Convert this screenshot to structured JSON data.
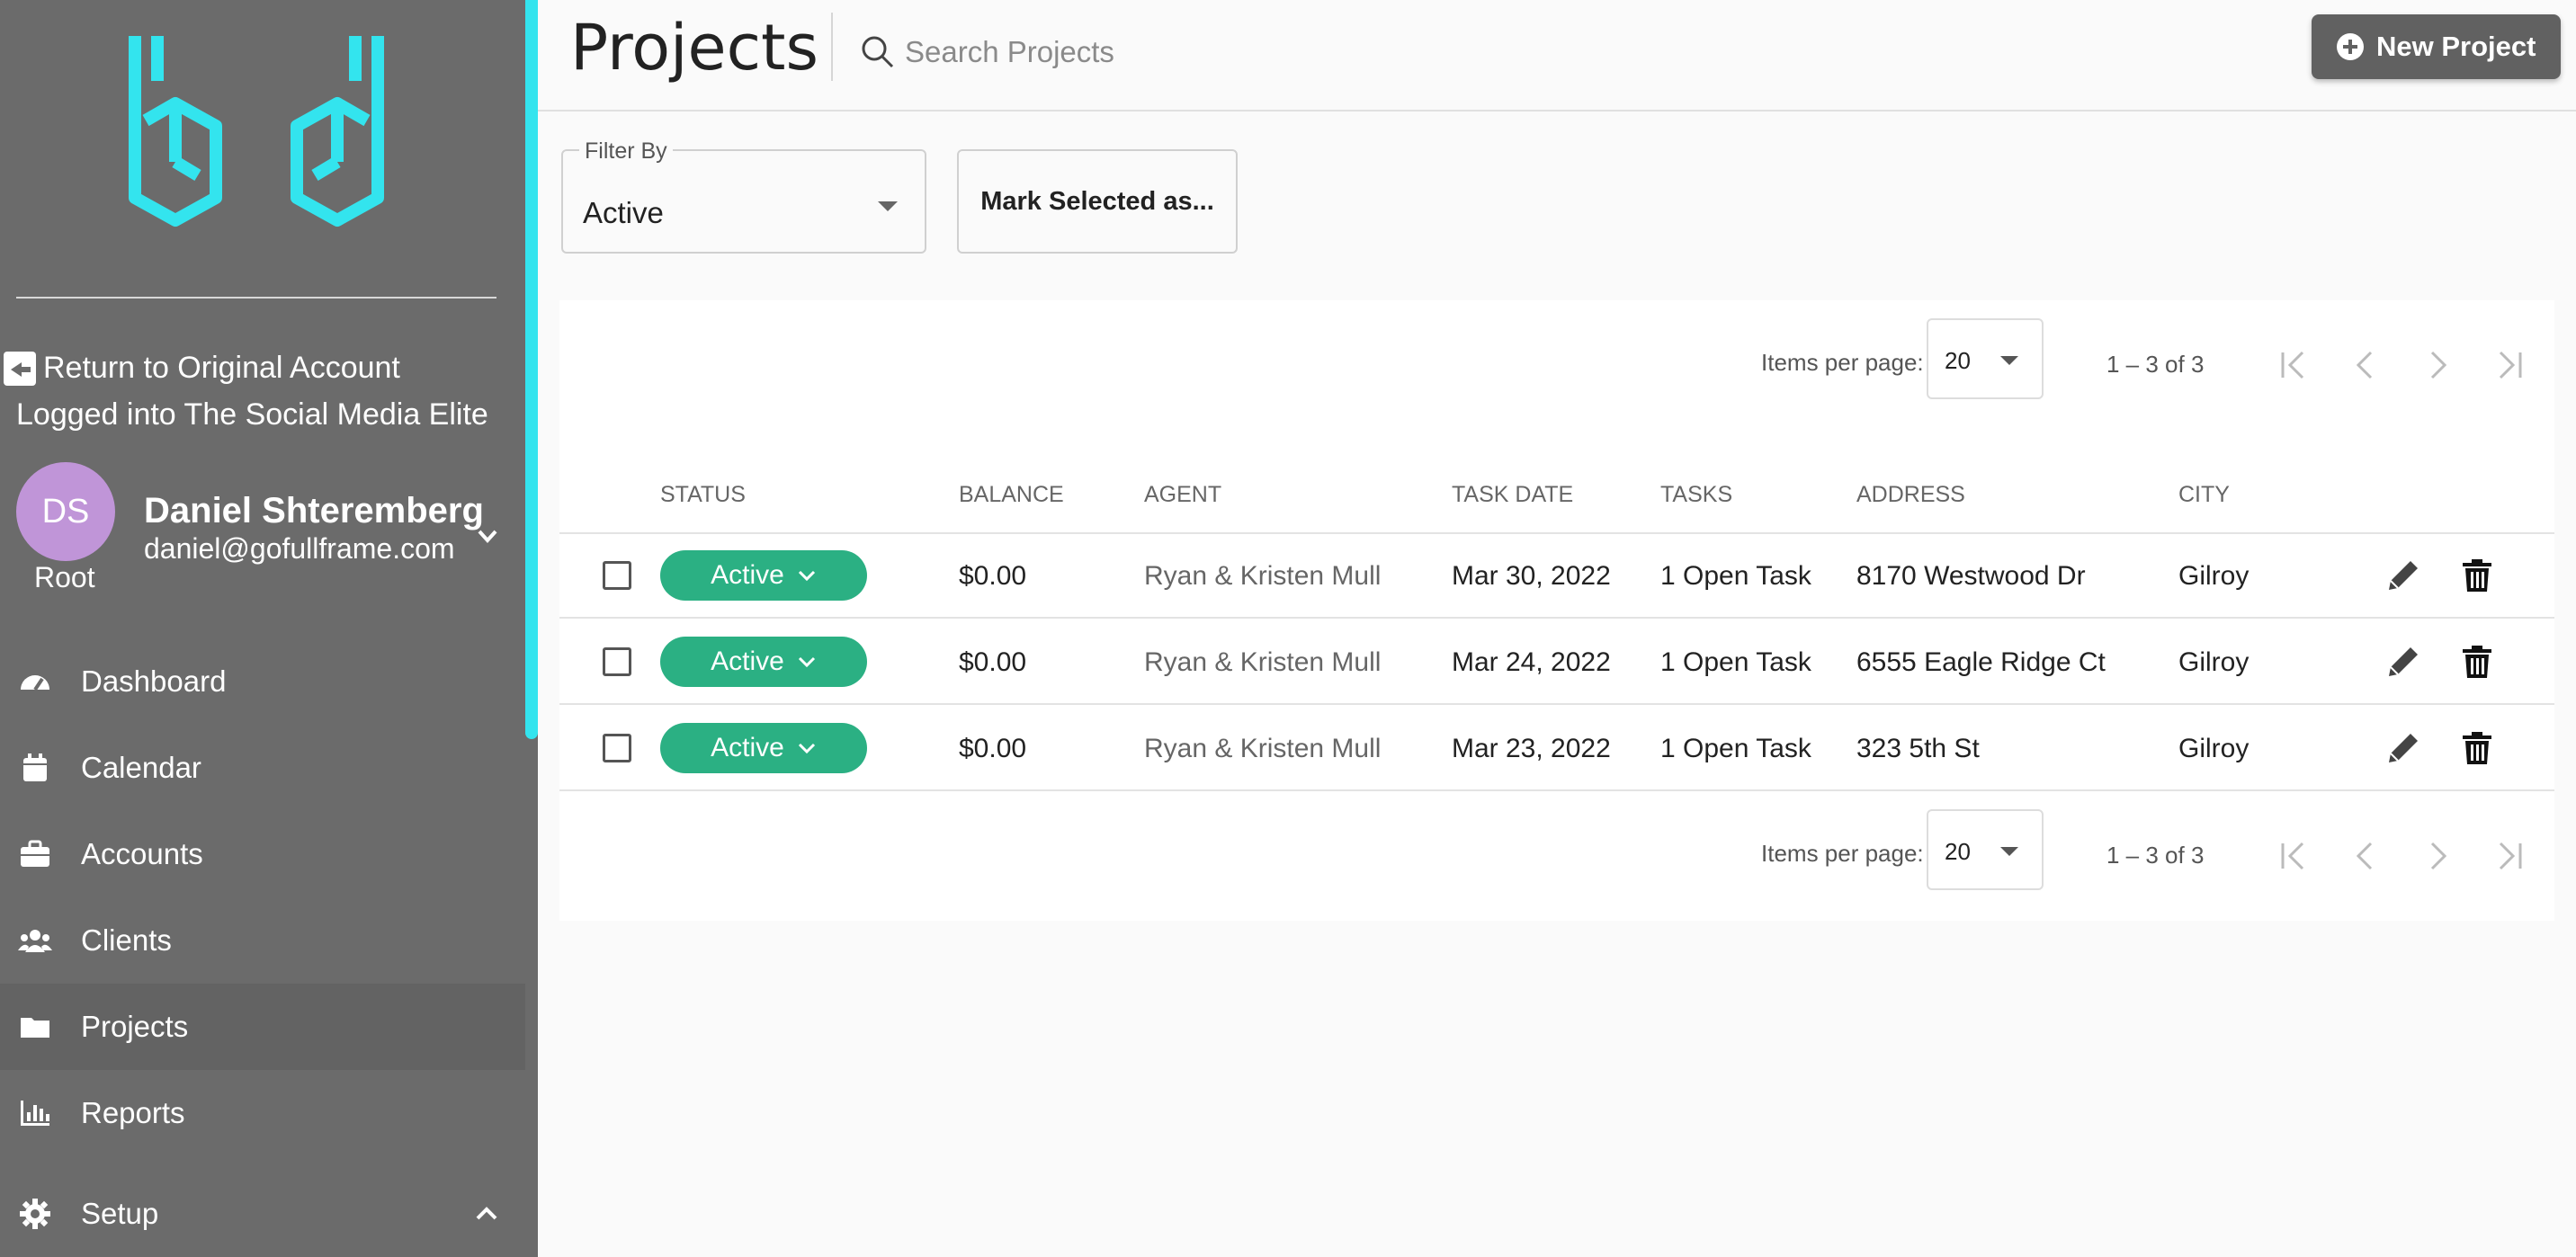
{
  "sidebar": {
    "return_label": "Return to Original Account",
    "logged_into": "Logged into The Social Media Elite",
    "user": {
      "initials": "DS",
      "role": "Root",
      "name": "Daniel Shteremberg",
      "email": "daniel@gofullframe.com"
    },
    "nav": [
      {
        "label": "Dashboard",
        "icon": "gauge-icon"
      },
      {
        "label": "Calendar",
        "icon": "calendar-icon"
      },
      {
        "label": "Accounts",
        "icon": "briefcase-icon"
      },
      {
        "label": "Clients",
        "icon": "users-icon"
      },
      {
        "label": "Projects",
        "icon": "folder-icon",
        "active": true
      },
      {
        "label": "Reports",
        "icon": "bar-chart-icon"
      },
      {
        "label": "Setup",
        "icon": "gear-icon",
        "expanded": true
      }
    ]
  },
  "header": {
    "title": "Projects",
    "search_placeholder": "Search Projects",
    "new_project_label": "New Project"
  },
  "filters": {
    "filter_by_label": "Filter By",
    "filter_by_value": "Active",
    "mark_selected_label": "Mark Selected as..."
  },
  "paginator": {
    "items_per_page_label": "Items per page:",
    "items_per_page_value": "20",
    "range_label": "1 – 3 of 3"
  },
  "table": {
    "columns": [
      "STATUS",
      "BALANCE",
      "AGENT",
      "TASK DATE",
      "TASKS",
      "ADDRESS",
      "CITY"
    ],
    "rows": [
      {
        "status": "Active",
        "balance": "$0.00",
        "agent": "Ryan & Kristen Mull",
        "task_date": "Mar 30, 2022",
        "tasks": "1 Open Task",
        "address": "8170 Westwood Dr",
        "city": "Gilroy"
      },
      {
        "status": "Active",
        "balance": "$0.00",
        "agent": "Ryan & Kristen Mull",
        "task_date": "Mar 24, 2022",
        "tasks": "1 Open Task",
        "address": "6555 Eagle Ridge Ct",
        "city": "Gilroy"
      },
      {
        "status": "Active",
        "balance": "$0.00",
        "agent": "Ryan & Kristen Mull",
        "task_date": "Mar 23, 2022",
        "tasks": "1 Open Task",
        "address": "323 5th St",
        "city": "Gilroy"
      }
    ]
  },
  "colors": {
    "sidebar_bg": "#6b6b6b",
    "accent": "#33e4ee",
    "status_active": "#2bb083",
    "avatar": "#c095d8",
    "button_dark": "#616161"
  }
}
